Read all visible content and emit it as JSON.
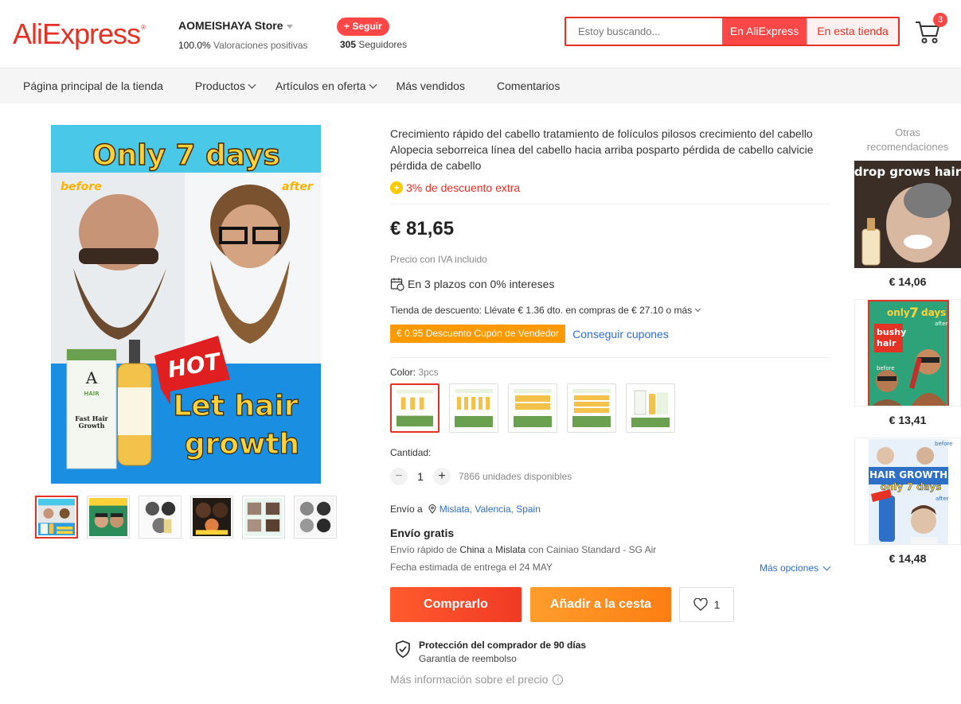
{
  "header": {
    "logo": "AliExpress",
    "store_name": "AOMEISHAYA Store",
    "rating_value": "100.0%",
    "rating_text": "Valoraciones positivas",
    "follow_label": "+ Seguir",
    "followers_count": "305",
    "followers_label": "Seguidores",
    "search_placeholder": "Estoy buscando...",
    "search_aliexpress": "En AliExpress",
    "search_store": "En esta tienda",
    "cart_count": "3"
  },
  "nav": {
    "items": [
      {
        "label": "Página principal de la tienda"
      },
      {
        "label": "Productos"
      },
      {
        "label": "Artículos en oferta"
      },
      {
        "label": "Más vendidos"
      },
      {
        "label": "Comentarios"
      }
    ]
  },
  "gallery": {
    "banner_top": "Only 7 days",
    "before": "before",
    "after": "after",
    "hot": "HOT",
    "tagline_1": "Let hair",
    "tagline_2": "growth",
    "box_brand": "HAIR",
    "box_title_1": "Fast Hair",
    "box_title_2": "Growth"
  },
  "product": {
    "title": "Crecimiento rápido del cabello tratamiento de folículos pilosos crecimiento del cabello Alopecia seborreica línea del cabello hacia arriba posparto pérdida de cabello calvicie pérdida de cabello",
    "extra_discount": "3% de descuento extra",
    "price": "€ 81,65",
    "iva": "Precio con IVA incluido",
    "installments": "En 3 plazos con 0% intereses",
    "store_discount": "Tienda de descuento: Llévate € 1.36 dto. en compras de € 27.10 o más",
    "coupon": "€ 0.95 Descuento Cupón de Vendedor",
    "get_coupons": "Conseguir cupones",
    "color_label": "Color:",
    "color_value": "3pcs",
    "quantity_label": "Cantidad:",
    "quantity": "1",
    "available": "7866 unidades disponibles",
    "ship_to_label": "Envío a",
    "ship_to": "Mislata, Valencia, Spain",
    "free_shipping": "Envío gratis",
    "shipping_desc_1": "Envío rápido de",
    "shipping_from": "China",
    "shipping_desc_2": "a",
    "shipping_to_city": "Mislata",
    "shipping_desc_3": "con Cainiao Standard - SG Air",
    "delivery": "Fecha estimada de entrega el 24 MAY",
    "more_options": "Más opciones",
    "buy_now": "Comprarlo",
    "add_to_cart": "Añadir a la cesta",
    "wish_count": "1",
    "protection_title": "Protección del comprador de 90 días",
    "protection_sub": "Garantía de reembolso",
    "price_info": "Más información sobre el precio"
  },
  "recommendations": {
    "title": "Otras recomendaciones",
    "items": [
      {
        "price": "€ 14,06",
        "caption": "drop grows hair"
      },
      {
        "price": "€ 13,41",
        "caption_1": "only",
        "caption_2": "7",
        "caption_3": "days",
        "caption_4": "bushy",
        "caption_5": "hair",
        "caption_6": "before",
        "caption_7": "after"
      },
      {
        "price": "€ 14,48",
        "caption_1": "HAIR GROWTH",
        "caption_2": "only 7 days",
        "caption_3": "before",
        "caption_4": "after"
      }
    ]
  },
  "colors": {
    "accent": "#e43225",
    "buy": "#f03a24",
    "cart": "#ff8c1a",
    "coupon": "#ff9900",
    "link": "#2e6fc7"
  }
}
